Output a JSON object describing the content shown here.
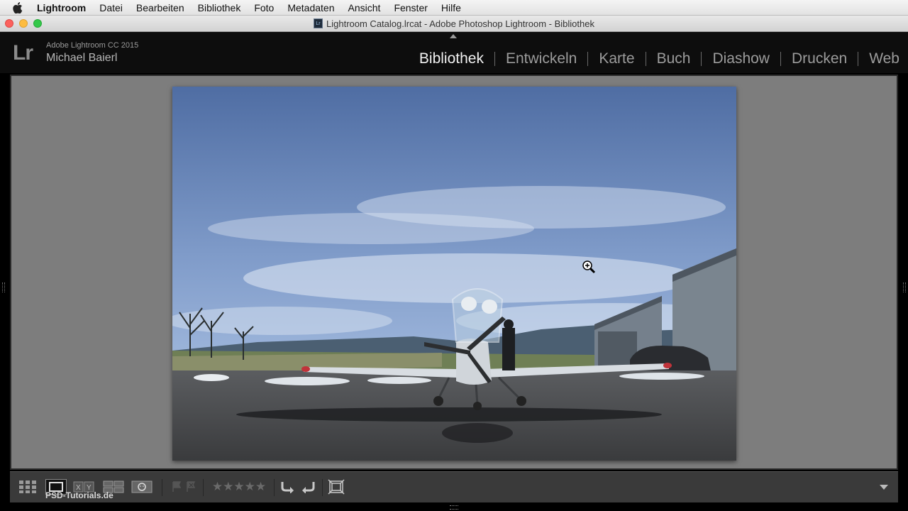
{
  "menubar": {
    "apple": "apple-icon",
    "items": [
      "Lightroom",
      "Datei",
      "Bearbeiten",
      "Bibliothek",
      "Foto",
      "Metadaten",
      "Ansicht",
      "Fenster",
      "Hilfe"
    ]
  },
  "window": {
    "title": "Lightroom Catalog.lrcat - Adobe Photoshop Lightroom - Bibliothek",
    "doc_icon_text": "Lr"
  },
  "identity": {
    "logo": "Lr",
    "product": "Adobe Lightroom CC 2015",
    "user": "Michael Baierl"
  },
  "modules": [
    "Bibliothek",
    "Entwickeln",
    "Karte",
    "Buch",
    "Diashow",
    "Drucken",
    "Web"
  ],
  "active_module": "Bibliothek",
  "toolbar": {
    "watermark": "PSD-Tutorials.de",
    "stars": "★★★★★",
    "icons": [
      "grid-view-icon",
      "loupe-view-icon",
      "compare-view-icon",
      "survey-view-icon",
      "people-view-icon",
      "flag-pick-icon",
      "flag-reject-icon",
      "star-rating-icon",
      "rotate-left-icon",
      "rotate-right-icon",
      "crop-icon",
      "toolbar-menu-icon"
    ]
  },
  "colors": {
    "background": "#7d7d7d",
    "active_module": "#f2f2f2",
    "inactive_module": "#9c9c9c"
  }
}
